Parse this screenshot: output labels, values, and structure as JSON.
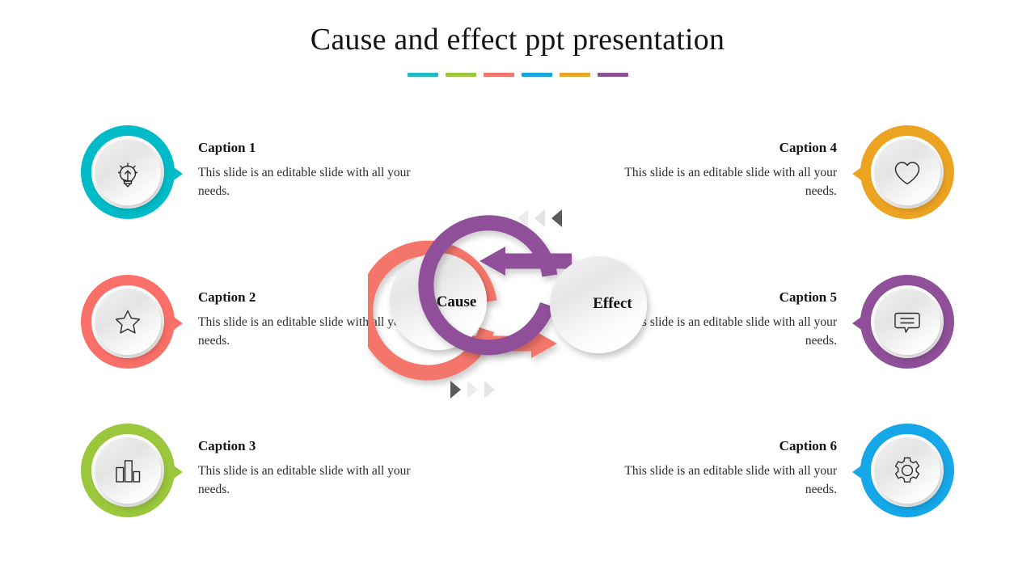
{
  "title": "Cause and effect ppt presentation",
  "title_rule_colors": [
    "#20b8c6",
    "#9ac73c",
    "#f4746b",
    "#16a3e2",
    "#eaa521",
    "#8f4f99"
  ],
  "center": {
    "cause_label": "Cause",
    "effect_label": "Effect",
    "cause_color": "#f4746b",
    "effect_color": "#8f4f99"
  },
  "markers": {
    "top": {
      "direction": "left",
      "colors": [
        "#ebebeb",
        "#e2e2e2",
        "#5a5a5a"
      ]
    },
    "bottom": {
      "direction": "right",
      "colors": [
        "#5a5a5a",
        "#ededed",
        "#e4e4e4"
      ]
    }
  },
  "features": [
    {
      "id": "caption-1",
      "side": "left",
      "title": "Caption 1",
      "body": "This slide is an editable slide with all your needs.",
      "color": "#00bcc8",
      "icon": "lightbulb-icon"
    },
    {
      "id": "caption-2",
      "side": "left",
      "title": "Caption 2",
      "body": "This slide is an editable slide with all your needs.",
      "color": "#fa7068",
      "icon": "star-icon"
    },
    {
      "id": "caption-3",
      "side": "left",
      "title": "Caption 3",
      "body": "This slide is an editable slide with all your needs.",
      "color": "#9ac73c",
      "icon": "bar-chart-icon"
    },
    {
      "id": "caption-4",
      "side": "right",
      "title": "Caption 4",
      "body": "This slide is an editable slide with all your needs.",
      "color": "#eda322",
      "icon": "heart-icon"
    },
    {
      "id": "caption-5",
      "side": "right",
      "title": "Caption 5",
      "body": "This slide is an editable slide with all your needs.",
      "color": "#8f4f99",
      "icon": "speech-bubble-icon"
    },
    {
      "id": "caption-6",
      "side": "right",
      "title": "Caption 6",
      "body": "This slide is an editable slide with all your needs.",
      "color": "#15a7e8",
      "icon": "gear-icon"
    }
  ]
}
